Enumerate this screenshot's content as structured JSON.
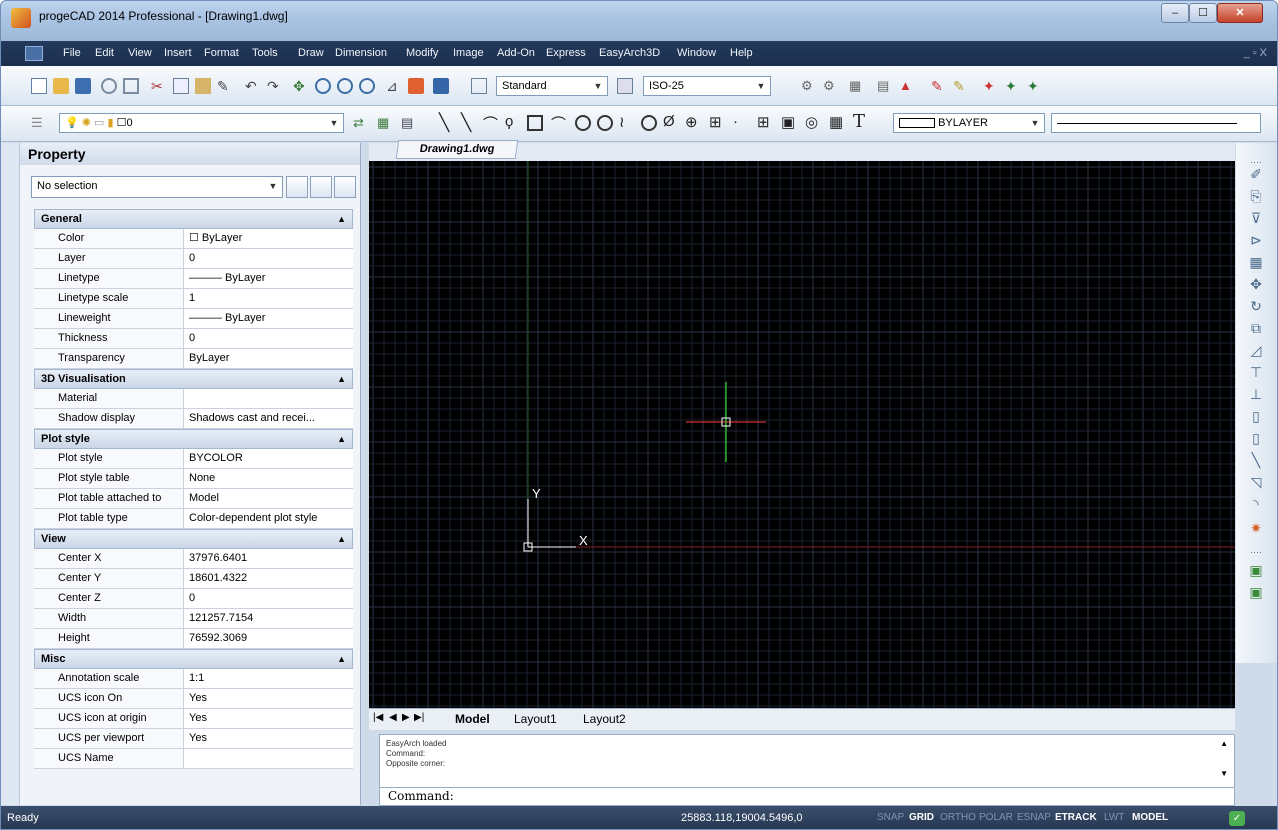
{
  "window": {
    "title": "progeCAD 2014 Professional - [Drawing1.dwg]",
    "min_label": "–",
    "max_label": "☐",
    "close_label": "✕"
  },
  "menubar": {
    "items": [
      "File",
      "Edit",
      "View",
      "Insert",
      "Format",
      "Tools",
      "Draw",
      "Dimension",
      "Modify",
      "Image",
      "Add-On",
      "Express",
      "EasyArch3D",
      "Window",
      "Help"
    ],
    "mdi_buttons": "_ ▫ X"
  },
  "toolbar": {
    "text_style": "Standard",
    "dim_style": "ISO-25",
    "layer": "0",
    "color": "BYLAYER"
  },
  "properties": {
    "title": "Property",
    "selection": "No selection",
    "sections": [
      {
        "name": "General",
        "rows": [
          [
            "Color",
            "☐ ByLayer"
          ],
          [
            "Layer",
            "0"
          ],
          [
            "Linetype",
            "——— ByLayer"
          ],
          [
            "Linetype scale",
            "1"
          ],
          [
            "Lineweight",
            "——— ByLayer"
          ],
          [
            "Thickness",
            "0"
          ],
          [
            "Transparency",
            "ByLayer"
          ]
        ]
      },
      {
        "name": "3D Visualisation",
        "rows": [
          [
            "Material",
            ""
          ],
          [
            "Shadow display",
            "Shadows cast and recei..."
          ]
        ]
      },
      {
        "name": "Plot style",
        "rows": [
          [
            "Plot style",
            "BYCOLOR"
          ],
          [
            "Plot style table",
            "None"
          ],
          [
            "Plot table attached to",
            "Model"
          ],
          [
            "Plot table type",
            "Color-dependent plot style"
          ]
        ]
      },
      {
        "name": "View",
        "rows": [
          [
            "Center X",
            "37976.6401"
          ],
          [
            "Center Y",
            "18601.4322"
          ],
          [
            "Center Z",
            "0"
          ],
          [
            "Width",
            "121257.7154"
          ],
          [
            "Height",
            "76592.3069"
          ]
        ]
      },
      {
        "name": "Misc",
        "rows": [
          [
            "Annotation scale",
            "1:1"
          ],
          [
            "UCS icon On",
            "Yes"
          ],
          [
            "UCS icon at origin",
            "Yes"
          ],
          [
            "UCS per viewport",
            "Yes"
          ],
          [
            "UCS Name",
            ""
          ]
        ]
      }
    ]
  },
  "drawing": {
    "tab": "Drawing1.dwg",
    "ucs_x": "X",
    "ucs_y": "Y"
  },
  "layouts": [
    "Model",
    "Layout1",
    "Layout2"
  ],
  "command": {
    "history": [
      "EasyArch loaded",
      "Command:",
      "Opposite corner:"
    ],
    "prompt": "Command:"
  },
  "status": {
    "ready": "Ready",
    "coords": "25883.118,19004.5496,0",
    "toggles": [
      {
        "label": "SNAP",
        "on": false
      },
      {
        "label": "GRID",
        "on": true
      },
      {
        "label": "ORTHO",
        "on": false
      },
      {
        "label": "POLAR",
        "on": false
      },
      {
        "label": "ESNAP",
        "on": false
      },
      {
        "label": "ETRACK",
        "on": true
      },
      {
        "label": "LWT",
        "on": false
      },
      {
        "label": "MODEL",
        "on": true
      }
    ]
  },
  "colors": {
    "canvas": "#000000",
    "grid_minor": "#1b2230",
    "grid_major": "#2a3447",
    "x_axis": "#8b1a1a",
    "y_axis": "#1c5e1c",
    "crosshair_x": "#ff3b3b",
    "crosshair_y": "#3bff3b"
  }
}
